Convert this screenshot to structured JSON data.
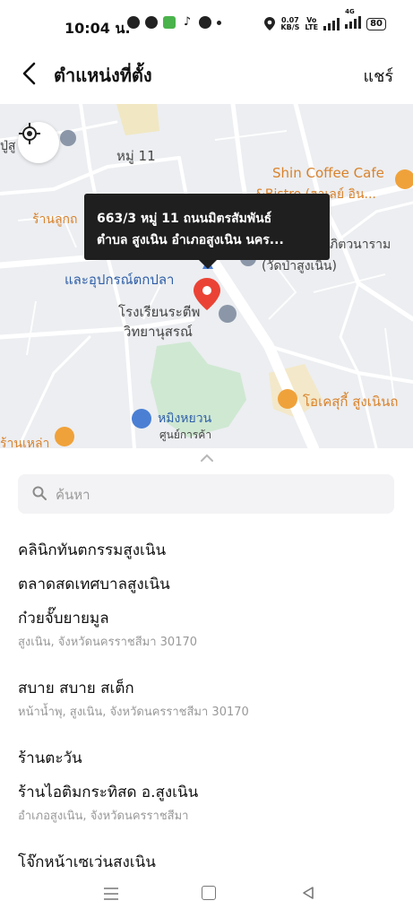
{
  "status_bar": {
    "time": "10:04 น.",
    "net_speed_top": "0.07",
    "net_speed_bottom": "KB/S",
    "volte_top": "Vo",
    "volte_bottom": "LTE",
    "network": "4G",
    "battery": "80"
  },
  "header": {
    "title": "ตำแหน่งที่ตั้ง",
    "share_label": "แชร์"
  },
  "map": {
    "tooltip_line1": "663/3 หมู่ 11 ถนนมิตรสัมพันธ์",
    "tooltip_line2": "ตำบล สูงเนิน อำเภอสูงเนิน นคร...",
    "labels": {
      "moo11": "หมู่ 11",
      "su": "ปู่สู",
      "shin_coffee": "Shin Coffee Cafe",
      "bistro": "&Bistro (ฮาเลย์ อิน...",
      "ran_luk": "ร้านลูกถ",
      "fishing": "และอุปกรณ์ตกปลา",
      "wat1": "ภิตวนาราม",
      "wat2": "(วัดป่าสูงเนิน)",
      "school1": "โรงเรียนระตีพ",
      "school2": "วิทยานุสรณ์",
      "okasuki": "โอเคสุกี้ สูงเนินถ",
      "mingyuan": "หมิงหยวน",
      "mall": "ศูนย์การค้า",
      "ranlao": "ร้านเหล่า"
    }
  },
  "search": {
    "placeholder": "ค้นหา",
    "value": ""
  },
  "results": [
    {
      "name": "คลินิกทันตกรรมสูงเนิน",
      "address": ""
    },
    {
      "name": "ตลาดสดเทศบาลสูงเนิน",
      "address": ""
    },
    {
      "name": "ก๋วยจั๊บยายมูล",
      "address": "สูงเนิน, จังหวัดนครราชสีมา 30170"
    },
    {
      "name": "สบาย สบาย สเต็ก",
      "address": "หน้าน้ำพุ, สูงเนิน, จังหวัดนครราชสีมา 30170"
    },
    {
      "name": "ร้านตะวัน",
      "address": ""
    },
    {
      "name": "ร้านไอติมกระทิสด อ.สูงเนิน",
      "address": "อำเภอสูงเนิน, จังหวัดนครราชสีมา"
    },
    {
      "name": "โจ๊กหน้าเซเว่นสงเนิน",
      "address": ""
    }
  ],
  "colors": {
    "pin": "#ea4335",
    "map_bg": "#eceef1",
    "road": "#ffffff",
    "park": "#cfe8d2",
    "poi_orange": "#f0a23a",
    "poi_blue": "#4a7fd4"
  }
}
